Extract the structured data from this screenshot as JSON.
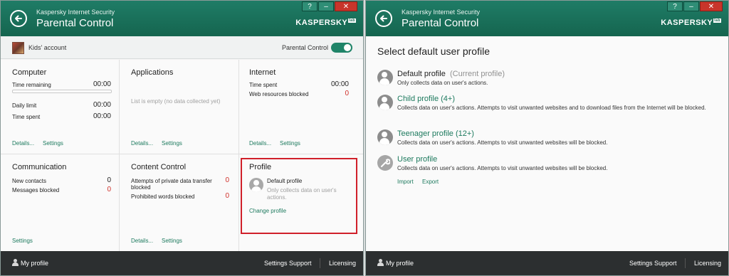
{
  "app": {
    "name": "Kaspersky Internet Security",
    "page_title": "Parental Control",
    "logo": "KASPERSKY",
    "logo_mark": "lab",
    "help": "?",
    "minimize": "–",
    "close": "✕"
  },
  "account": {
    "name": "Kids' account",
    "parental_control_label": "Parental Control",
    "parental_control_on": true
  },
  "tiles": {
    "computer": {
      "title": "Computer",
      "time_remaining_label": "Time remaining",
      "time_remaining": "00:00",
      "time_remaining_fraction": 0,
      "daily_limit_label": "Daily limit",
      "daily_limit": "00:00",
      "time_spent_label": "Time spent",
      "time_spent": "00:00",
      "details": "Details...",
      "settings": "Settings"
    },
    "applications": {
      "title": "Applications",
      "empty": "List is empty (no data collected yet)",
      "details": "Details...",
      "settings": "Settings"
    },
    "internet": {
      "title": "Internet",
      "time_spent_label": "Time spent",
      "time_spent": "00:00",
      "blocked_label": "Web resources blocked",
      "blocked": "0",
      "details": "Details...",
      "settings": "Settings"
    },
    "communication": {
      "title": "Communication",
      "new_contacts_label": "New contacts",
      "new_contacts": "0",
      "messages_blocked_label": "Messages blocked",
      "messages_blocked": "0",
      "settings": "Settings"
    },
    "content_control": {
      "title": "Content Control",
      "transfer_label_1": "Attempts of private data transfer",
      "transfer_label_2": "blocked",
      "transfer_value": "0",
      "prohibited_label": "Prohibited words blocked",
      "prohibited_value": "0",
      "details": "Details...",
      "settings": "Settings"
    },
    "profile": {
      "title": "Profile",
      "name": "Default profile",
      "desc_1": "Only collects data on user's",
      "desc_2": "actions.",
      "change": "Change profile"
    }
  },
  "footer": {
    "my_profile": "My profile",
    "settings": "Settings",
    "support": "Support",
    "licensing": "Licensing"
  },
  "right": {
    "heading": "Select default user profile",
    "profiles": [
      {
        "name": "Default profile",
        "current": "(Current profile)",
        "desc": "Only collects data on user's actions."
      },
      {
        "name": "Child profile (4+)",
        "desc": "Collects data on user's actions. Attempts to visit unwanted websites and to download files from the Internet will be blocked."
      },
      {
        "name": "Teenager profile (12+)",
        "desc": "Collects data on user's actions. Attempts to visit unwanted websites will be blocked."
      },
      {
        "name": "User profile",
        "desc": "Collects data on user's actions. Attempts to visit unwanted websites will be blocked."
      }
    ],
    "import": "Import",
    "export": "Export"
  },
  "colors": {
    "titlebar": "#17705a",
    "accent": "#1d7a5e",
    "alert": "#d0302a",
    "footer": "#2c2f30",
    "highlight": "#d0202a"
  },
  "icons": [
    "back-arrow-icon",
    "person-icon",
    "wrench-icon",
    "user-icon",
    "toggle-switch-icon"
  ]
}
